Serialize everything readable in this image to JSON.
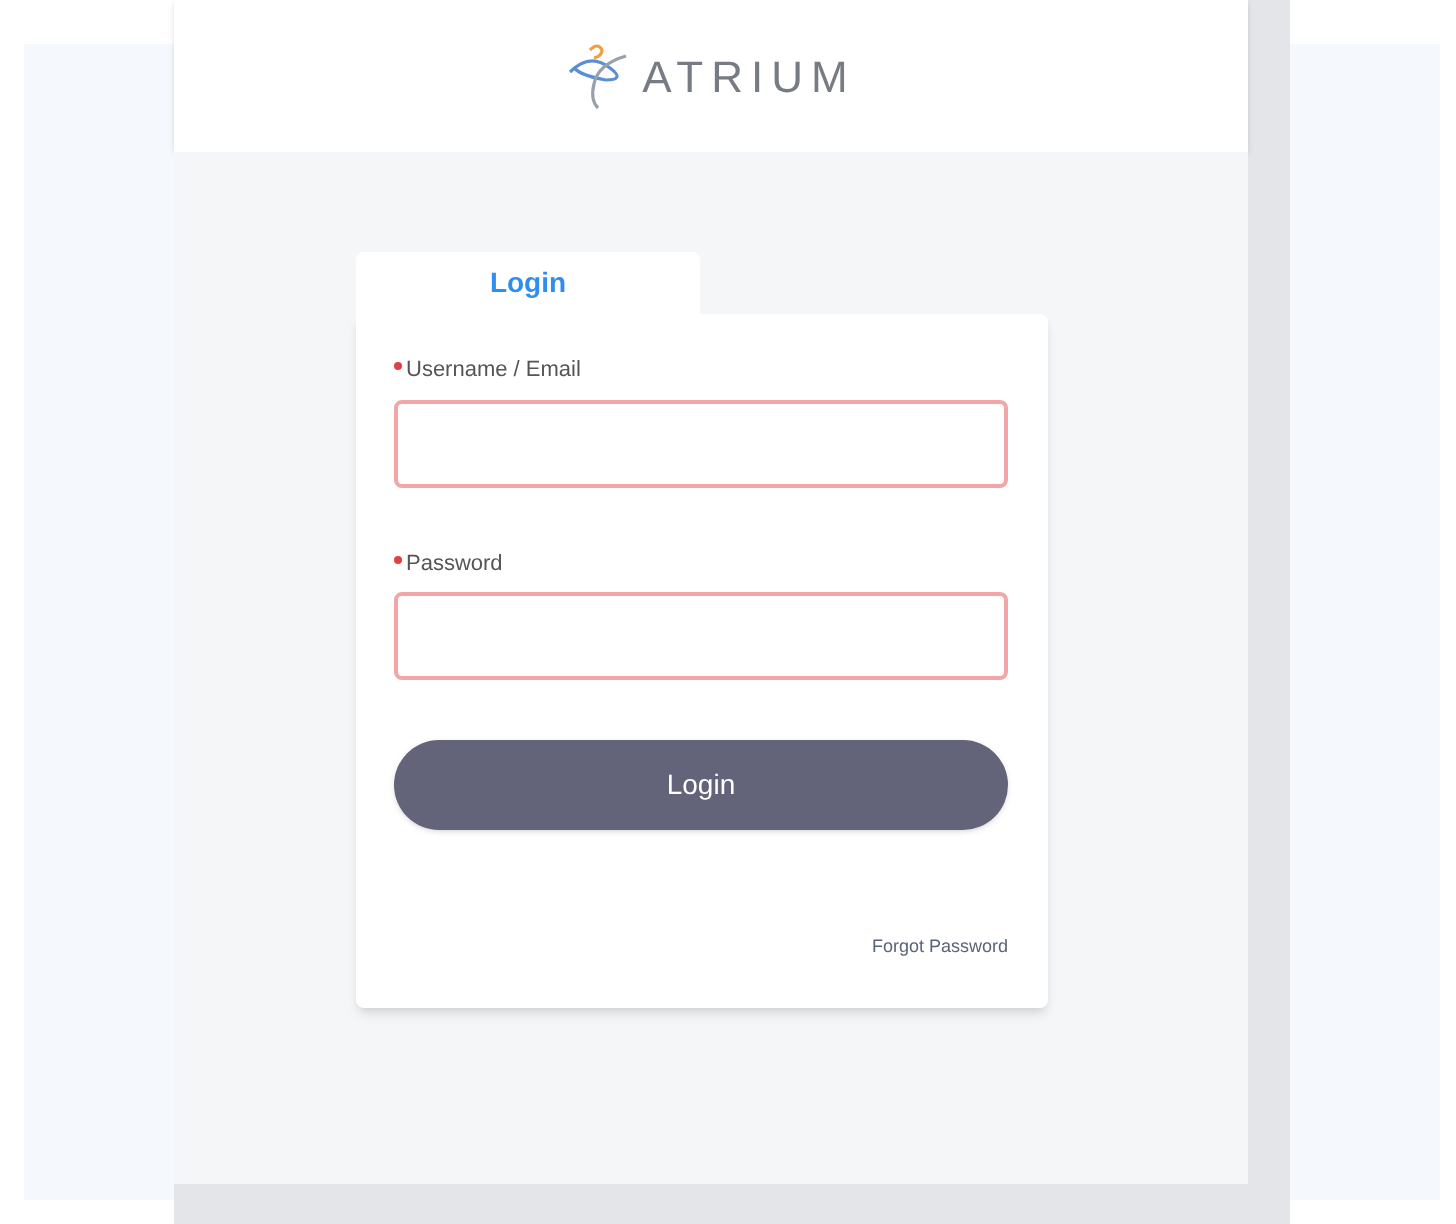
{
  "header": {
    "logo_text": "ATRIUM"
  },
  "tabs": [
    {
      "label": "Login",
      "selected": true
    }
  ],
  "fields": [
    {
      "label": "Username / Email",
      "required": true,
      "invalid": true
    },
    {
      "label": "Password",
      "required": true,
      "invalid": true
    }
  ],
  "submit": {
    "label": "Login"
  },
  "forgot_link": "Forgot Password"
}
